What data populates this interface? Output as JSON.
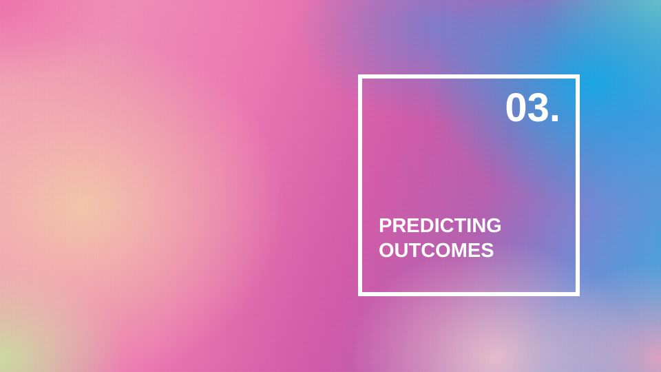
{
  "slide": {
    "number": "03.",
    "title_lines": [
      "PREDICTING",
      "OUTCOMES"
    ]
  },
  "colors": {
    "frame": "#ffffff",
    "text": "#ffffff",
    "gradient_pink": "#ec77b2",
    "gradient_blue": "#10a8e6",
    "gradient_peach": "#f5c8aa",
    "gradient_green": "#c8e1a0"
  }
}
